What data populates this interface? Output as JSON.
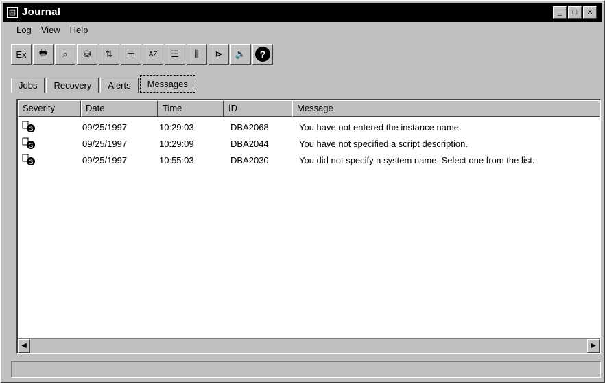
{
  "window": {
    "title": "Journal"
  },
  "menu": [
    "Log",
    "View",
    "Help"
  ],
  "toolbar": {
    "buttons": [
      {
        "icon": "exit-icon",
        "label": "Ex"
      },
      {
        "icon": "print-icon"
      },
      {
        "icon": "search-icon"
      },
      {
        "icon": "database-icon"
      },
      {
        "icon": "arrow-swap-icon"
      },
      {
        "icon": "window-icon"
      },
      {
        "icon": "sort-ascending-icon",
        "label": "AZ"
      },
      {
        "icon": "sort-list-icon"
      },
      {
        "icon": "columns-icon"
      },
      {
        "icon": "filter-icon"
      },
      {
        "icon": "speaker-icon"
      },
      {
        "icon": "help-icon",
        "label": "?"
      }
    ]
  },
  "tabs": [
    "Jobs",
    "Recovery",
    "Alerts",
    "Messages"
  ],
  "active_tab": "Messages",
  "table": {
    "columns": [
      "Severity",
      "Date",
      "Time",
      "ID",
      "Message"
    ],
    "rows": [
      {
        "date": "09/25/1997",
        "time": "10:29:03",
        "id": "DBA2068",
        "message": "You have not entered the instance name."
      },
      {
        "date": "09/25/1997",
        "time": "10:29:09",
        "id": "DBA2044",
        "message": "You have not specified a script description."
      },
      {
        "date": "09/25/1997",
        "time": "10:55:03",
        "id": "DBA2030",
        "message": "You did not specify a system name.  Select one from the list."
      }
    ]
  }
}
